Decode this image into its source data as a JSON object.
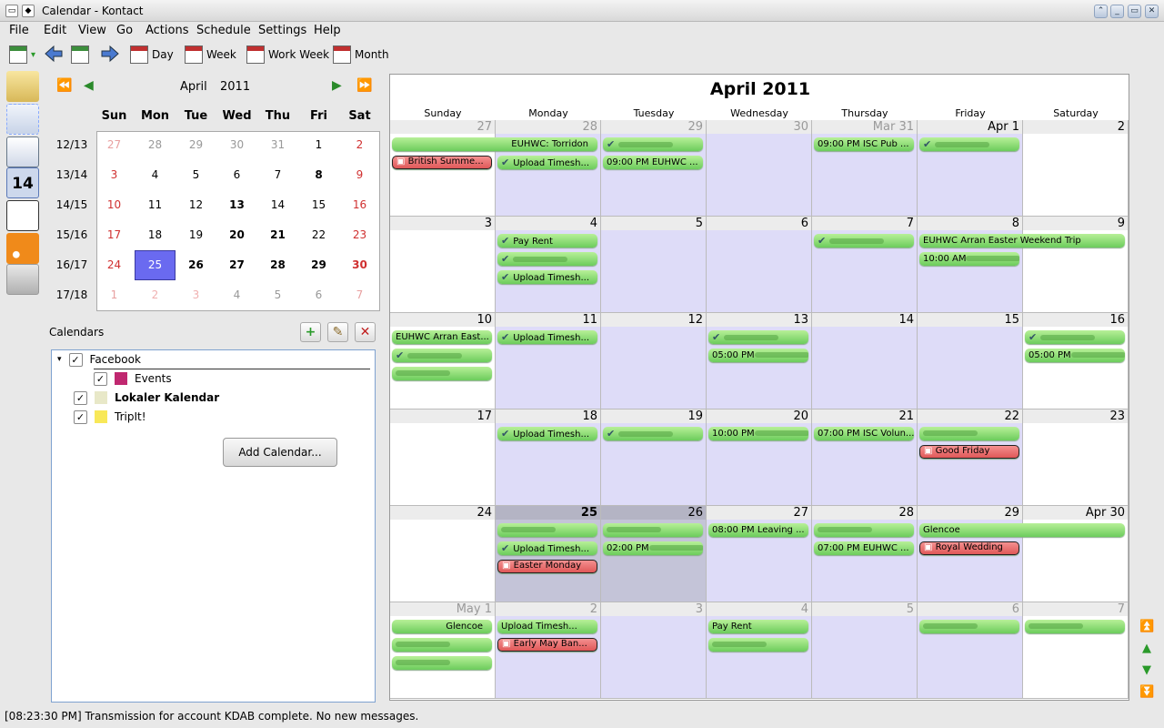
{
  "window": {
    "title": "Calendar - Kontact"
  },
  "menu": [
    "File",
    "Edit",
    "View",
    "Go",
    "Actions",
    "Schedule",
    "Settings",
    "Help"
  ],
  "toolbar": {
    "day": "Day",
    "week": "Week",
    "work_week": "Work Week",
    "month": "Month"
  },
  "mini_calendar": {
    "month": "April",
    "year": "2011",
    "weekdays": [
      "Sun",
      "Mon",
      "Tue",
      "Wed",
      "Thu",
      "Fri",
      "Sat"
    ],
    "weeks": [
      {
        "label": "12/13",
        "days": [
          "27",
          "28",
          "29",
          "30",
          "31",
          "1",
          "2"
        ]
      },
      {
        "label": "13/14",
        "days": [
          "3",
          "4",
          "5",
          "6",
          "7",
          "8",
          "9"
        ]
      },
      {
        "label": "14/15",
        "days": [
          "10",
          "11",
          "12",
          "13",
          "14",
          "15",
          "16"
        ]
      },
      {
        "label": "15/16",
        "days": [
          "17",
          "18",
          "19",
          "20",
          "21",
          "22",
          "23"
        ]
      },
      {
        "label": "16/17",
        "days": [
          "24",
          "25",
          "26",
          "27",
          "28",
          "29",
          "30"
        ]
      },
      {
        "label": "17/18",
        "days": [
          "1",
          "2",
          "3",
          "4",
          "5",
          "6",
          "7"
        ]
      }
    ],
    "selected": "25"
  },
  "calendars": {
    "header": "Calendars",
    "items": [
      {
        "label": "Facebook",
        "checked": true
      },
      {
        "label": "Events",
        "checked": true,
        "color": "#c02870"
      },
      {
        "label": "Lokaler Kalendar",
        "checked": true,
        "color": "#e8e8c8"
      },
      {
        "label": "TripIt!",
        "checked": true,
        "color": "#f8e858"
      }
    ],
    "add_button": "Add Calendar..."
  },
  "month_view": {
    "title": "April 2011",
    "weekdays": [
      "Sunday",
      "Monday",
      "Tuesday",
      "Wednesday",
      "Thursday",
      "Friday",
      "Saturday"
    ],
    "weeks": [
      {
        "days": [
          "27",
          "28",
          "29",
          "30",
          "Mar 31",
          "Apr 1",
          "2"
        ]
      },
      {
        "days": [
          "3",
          "4",
          "5",
          "6",
          "7",
          "8",
          "9"
        ]
      },
      {
        "days": [
          "10",
          "11",
          "12",
          "13",
          "14",
          "15",
          "16"
        ]
      },
      {
        "days": [
          "17",
          "18",
          "19",
          "20",
          "21",
          "22",
          "23"
        ]
      },
      {
        "days": [
          "24",
          "25",
          "26",
          "27",
          "28",
          "29",
          "Apr 30"
        ]
      },
      {
        "days": [
          "May 1",
          "2",
          "3",
          "4",
          "5",
          "6",
          "7"
        ]
      }
    ],
    "events": [
      {
        "w": 0,
        "d": 0,
        "span": 2,
        "slot": 0,
        "text": "EUHWC: Torridon",
        "type": "green",
        "align": "right"
      },
      {
        "w": 0,
        "d": 0,
        "slot": 1,
        "text": "British Summe...",
        "type": "red"
      },
      {
        "w": 0,
        "d": 1,
        "slot": 1,
        "text": "Upload Timesh...",
        "type": "check"
      },
      {
        "w": 0,
        "d": 2,
        "slot": 0,
        "text": "",
        "type": "check-blur"
      },
      {
        "w": 0,
        "d": 2,
        "slot": 1,
        "text": "09:00 PM EUHWC ...",
        "type": "green"
      },
      {
        "w": 0,
        "d": 4,
        "slot": 0,
        "text": "09:00 PM ISC Pub ...",
        "type": "green"
      },
      {
        "w": 0,
        "d": 5,
        "slot": 0,
        "text": "",
        "type": "check-blur"
      },
      {
        "w": 1,
        "d": 1,
        "slot": 0,
        "text": "Pay Rent",
        "type": "check"
      },
      {
        "w": 1,
        "d": 1,
        "slot": 1,
        "text": "",
        "type": "check-blur"
      },
      {
        "w": 1,
        "d": 1,
        "slot": 2,
        "text": "Upload Timesh...",
        "type": "check"
      },
      {
        "w": 1,
        "d": 4,
        "slot": 0,
        "text": "",
        "type": "check-blur"
      },
      {
        "w": 1,
        "d": 5,
        "span": 2,
        "slot": 0,
        "text": "EUHWC Arran Easter Weekend Trip",
        "type": "green"
      },
      {
        "w": 1,
        "d": 5,
        "slot": 1,
        "text": "10:00 AM",
        "type": "green-blur"
      },
      {
        "w": 2,
        "d": 0,
        "slot": 0,
        "text": "EUHWC Arran East...",
        "type": "green"
      },
      {
        "w": 2,
        "d": 0,
        "slot": 1,
        "text": "",
        "type": "check-blur"
      },
      {
        "w": 2,
        "d": 0,
        "slot": 2,
        "text": "",
        "type": "green-blur"
      },
      {
        "w": 2,
        "d": 1,
        "slot": 0,
        "text": "Upload Timesh...",
        "type": "check"
      },
      {
        "w": 2,
        "d": 3,
        "slot": 0,
        "text": "",
        "type": "check-blur"
      },
      {
        "w": 2,
        "d": 3,
        "slot": 1,
        "text": "05:00 PM",
        "type": "green-blur"
      },
      {
        "w": 2,
        "d": 6,
        "slot": 0,
        "text": "",
        "type": "check-blur"
      },
      {
        "w": 2,
        "d": 6,
        "slot": 1,
        "text": "05:00 PM",
        "type": "green-blur"
      },
      {
        "w": 3,
        "d": 1,
        "slot": 0,
        "text": "Upload Timesh...",
        "type": "check"
      },
      {
        "w": 3,
        "d": 2,
        "slot": 0,
        "text": "",
        "type": "check-blur"
      },
      {
        "w": 3,
        "d": 3,
        "slot": 0,
        "text": "10:00 PM",
        "type": "green-blur"
      },
      {
        "w": 3,
        "d": 4,
        "slot": 0,
        "text": "07:00 PM ISC Volun...",
        "type": "green"
      },
      {
        "w": 3,
        "d": 5,
        "slot": 0,
        "text": "",
        "type": "green-blur"
      },
      {
        "w": 3,
        "d": 5,
        "slot": 1,
        "text": "Good Friday",
        "type": "red"
      },
      {
        "w": 4,
        "d": 1,
        "slot": 0,
        "text": "",
        "type": "green-blur"
      },
      {
        "w": 4,
        "d": 1,
        "slot": 1,
        "text": "Upload Timesh...",
        "type": "check"
      },
      {
        "w": 4,
        "d": 1,
        "slot": 2,
        "text": "Easter Monday",
        "type": "red"
      },
      {
        "w": 4,
        "d": 2,
        "slot": 0,
        "text": "",
        "type": "green-blur"
      },
      {
        "w": 4,
        "d": 2,
        "slot": 1,
        "text": "02:00 PM",
        "type": "green-blur"
      },
      {
        "w": 4,
        "d": 3,
        "slot": 0,
        "text": "08:00 PM Leaving ...",
        "type": "green"
      },
      {
        "w": 4,
        "d": 4,
        "slot": 0,
        "text": "",
        "type": "green-blur"
      },
      {
        "w": 4,
        "d": 4,
        "slot": 1,
        "text": "07:00 PM EUHWC ...",
        "type": "green"
      },
      {
        "w": 4,
        "d": 5,
        "span": 2,
        "slot": 0,
        "text": "Glencoe",
        "type": "green"
      },
      {
        "w": 4,
        "d": 5,
        "slot": 1,
        "text": "Royal Wedding",
        "type": "red"
      },
      {
        "w": 5,
        "d": 0,
        "slot": 0,
        "text": "Glencoe",
        "type": "green",
        "align": "right"
      },
      {
        "w": 5,
        "d": 0,
        "slot": 1,
        "text": "",
        "type": "green-blur"
      },
      {
        "w": 5,
        "d": 0,
        "slot": 2,
        "text": "",
        "type": "green-blur"
      },
      {
        "w": 5,
        "d": 1,
        "slot": 0,
        "text": "Upload Timesh...",
        "type": "green"
      },
      {
        "w": 5,
        "d": 1,
        "slot": 1,
        "text": "Early May Ban...",
        "type": "red"
      },
      {
        "w": 5,
        "d": 3,
        "slot": 0,
        "text": "Pay Rent",
        "type": "green"
      },
      {
        "w": 5,
        "d": 3,
        "slot": 1,
        "text": "",
        "type": "green-blur"
      },
      {
        "w": 5,
        "d": 5,
        "slot": 0,
        "text": "",
        "type": "green-blur"
      },
      {
        "w": 5,
        "d": 6,
        "slot": 0,
        "text": "",
        "type": "green-blur"
      }
    ]
  },
  "status": "[08:23:30 PM] Transmission for account KDAB complete. No new messages."
}
